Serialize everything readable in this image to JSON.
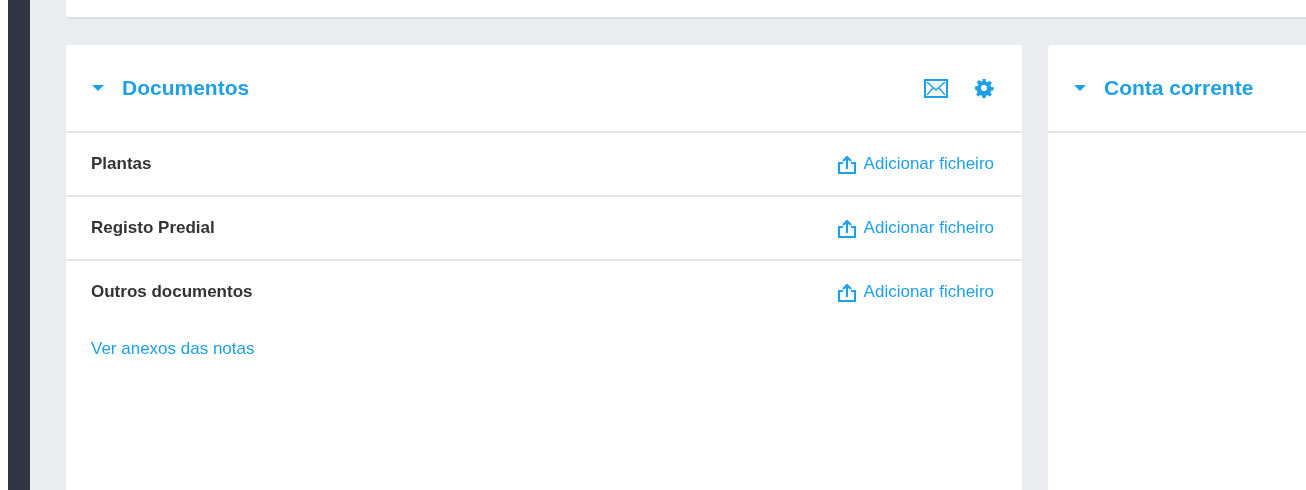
{
  "panels": [
    {
      "title": "Documentos",
      "expanded": true,
      "header_icons": [
        {
          "kind": "mail"
        },
        {
          "kind": "settings"
        }
      ],
      "rows": [
        {
          "label": "Plantas",
          "action": "Adicionar ficheiro"
        },
        {
          "label": "Registo Predial",
          "action": "Adicionar ficheiro"
        },
        {
          "label": "Outros documentos",
          "action": "Adicionar ficheiro"
        }
      ],
      "link": "Ver anexos das notas"
    },
    {
      "title": "Conta corrente",
      "expanded": true
    }
  ]
}
